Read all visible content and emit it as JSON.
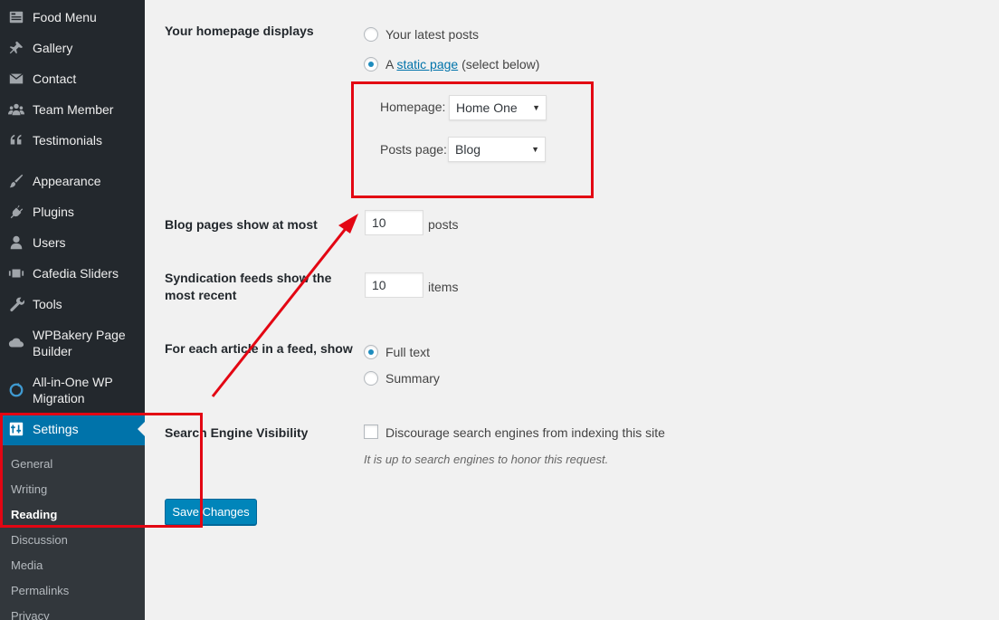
{
  "sidebar": {
    "items": [
      {
        "label": "Food Menu",
        "icon": "food-menu-icon"
      },
      {
        "label": "Gallery",
        "icon": "pin-icon"
      },
      {
        "label": "Contact",
        "icon": "envelope-icon"
      },
      {
        "label": "Team Member",
        "icon": "users-group-icon"
      },
      {
        "label": "Testimonials",
        "icon": "quote-icon"
      },
      {
        "label": "Appearance",
        "icon": "brush-icon"
      },
      {
        "label": "Plugins",
        "icon": "plug-icon"
      },
      {
        "label": "Users",
        "icon": "user-icon"
      },
      {
        "label": "Cafedia Sliders",
        "icon": "slides-icon"
      },
      {
        "label": "Tools",
        "icon": "wrench-icon"
      },
      {
        "label": "WPBakery Page Builder",
        "icon": "cloud-icon"
      },
      {
        "label": "All-in-One WP Migration",
        "icon": "migration-icon"
      },
      {
        "label": "Settings",
        "icon": "settings-icon"
      }
    ],
    "submenu": [
      "General",
      "Writing",
      "Reading",
      "Discussion",
      "Media",
      "Permalinks",
      "Privacy"
    ],
    "current_submenu": "Reading"
  },
  "reading": {
    "homepage_displays": {
      "label": "Your homepage displays",
      "option_latest": "Your latest posts",
      "option_static_prefix": "A",
      "option_static_link": "static page",
      "option_static_suffix": "(select below)",
      "selected": "static page"
    },
    "homepage_select": {
      "label": "Homepage:",
      "value": "Home One"
    },
    "posts_page_select": {
      "label": "Posts page:",
      "value": "Blog"
    },
    "blog_pages": {
      "label": "Blog pages show at most",
      "value": "10",
      "unit": "posts"
    },
    "syndication": {
      "label": "Syndication feeds show the most recent",
      "value": "10",
      "unit": "items"
    },
    "feed_article": {
      "label": "For each article in a feed, show",
      "option_full": "Full text",
      "option_summary": "Summary",
      "selected": "Full text"
    },
    "search_visibility": {
      "label": "Search Engine Visibility",
      "checkbox_label": "Discourage search engines from indexing this site",
      "checked": false,
      "description": "It is up to search engines to honor this request."
    },
    "save_label": "Save Changes"
  },
  "colors": {
    "accent": "#0073aa",
    "annotation": "#e30613",
    "sidebar": "#23282d"
  }
}
